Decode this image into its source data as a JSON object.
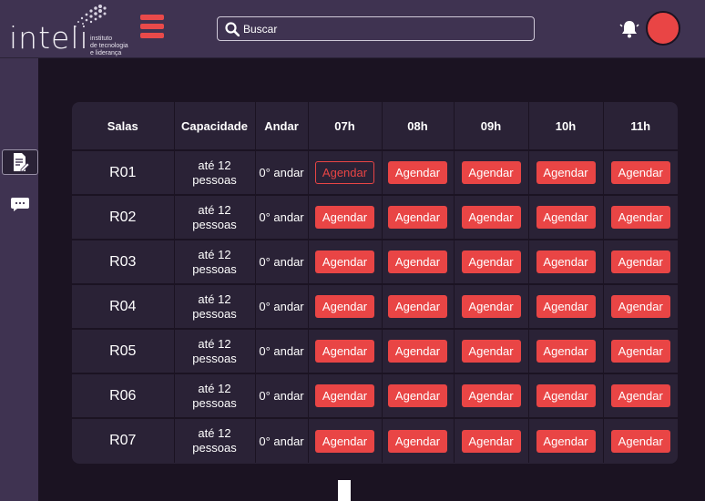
{
  "header": {
    "logo_word": "inteli",
    "logo_sub": [
      "instituto",
      "de tecnologia",
      "e liderança"
    ],
    "search_placeholder": "Buscar",
    "icons": {
      "menu": "hamburger-icon",
      "search": "search-icon",
      "bell": "bell-icon"
    }
  },
  "sidebar": {
    "items": [
      {
        "icon": "document-edit-icon",
        "active": true
      },
      {
        "icon": "message-icon",
        "active": false
      }
    ]
  },
  "colors": {
    "background": "#1b1322",
    "topbar": "#3f3351",
    "table": "#2a2236",
    "accent": "#e94545"
  },
  "table": {
    "headers": [
      "Salas",
      "Capacidade",
      "Andar",
      "07h",
      "08h",
      "09h",
      "10h",
      "11h"
    ],
    "button_label": "Agendar",
    "rows": [
      {
        "room": "R01",
        "capacity": [
          "até 12",
          "pessoas"
        ],
        "floor": "0° andar",
        "first_outlined": true
      },
      {
        "room": "R02",
        "capacity": [
          "até 12",
          "pessoas"
        ],
        "floor": "0° andar",
        "first_outlined": false
      },
      {
        "room": "R03",
        "capacity": [
          "até 12",
          "pessoas"
        ],
        "floor": "0° andar",
        "first_outlined": false
      },
      {
        "room": "R04",
        "capacity": [
          "até 12",
          "pessoas"
        ],
        "floor": "0° andar",
        "first_outlined": false
      },
      {
        "room": "R05",
        "capacity": [
          "até 12",
          "pessoas"
        ],
        "floor": "0° andar",
        "first_outlined": false
      },
      {
        "room": "R06",
        "capacity": [
          "até 12",
          "pessoas"
        ],
        "floor": "0° andar",
        "first_outlined": false
      },
      {
        "room": "R07",
        "capacity": [
          "até 12",
          "pessoas"
        ],
        "floor": "0° andar",
        "first_outlined": false
      }
    ]
  }
}
